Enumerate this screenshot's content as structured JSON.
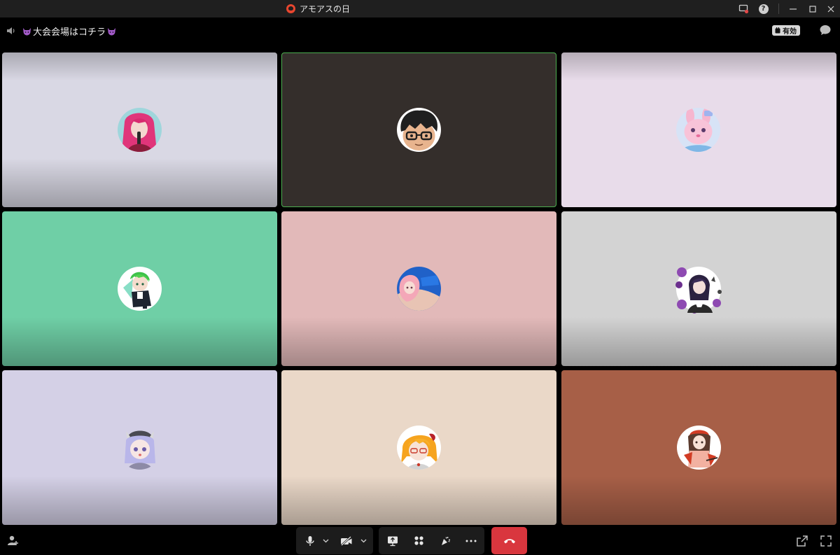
{
  "window": {
    "title": "アモアスの日",
    "colors": {
      "titlebar_bg": "#1f1f1f",
      "accent_active": "#4caf50",
      "end_call": "#d9363e"
    }
  },
  "header": {
    "meeting_name": "大会会場はコチラ",
    "status_badge": "有効",
    "icons": [
      "speaker-icon",
      "devil-emoji-icon",
      "chat-icon"
    ]
  },
  "grid": {
    "tiles": [
      {
        "bg": "#d9d8e4",
        "avatar": "pink-hair-character",
        "active": false
      },
      {
        "bg": "#342e2b",
        "avatar": "glasses-character",
        "active": true
      },
      {
        "bg": "#e8dcea",
        "avatar": "pink-bunny-character",
        "active": false
      },
      {
        "bg": "#6fcfa6",
        "avatar": "green-hair-character",
        "active": false
      },
      {
        "bg": "#e2b9b9",
        "avatar": "pink-hair-blue-bg-character",
        "active": false
      },
      {
        "bg": "#d3d3d3",
        "avatar": "purple-rose-character",
        "active": false
      },
      {
        "bg": "#d4d0e6",
        "avatar": "lavender-hair-character",
        "active": false
      },
      {
        "bg": "#ead8c8",
        "avatar": "orange-hair-character",
        "active": false
      },
      {
        "bg": "#a75f47",
        "avatar": "red-hat-character",
        "active": false
      }
    ]
  },
  "toolbar": {
    "controls": [
      "microphone-icon",
      "video-off-icon",
      "share-screen-icon",
      "apps-icon",
      "reactions-icon",
      "more-icon",
      "end-call-icon"
    ],
    "corner_left": "add-participant-icon",
    "corner_right": [
      "popout-icon",
      "fullscreen-icon"
    ]
  }
}
